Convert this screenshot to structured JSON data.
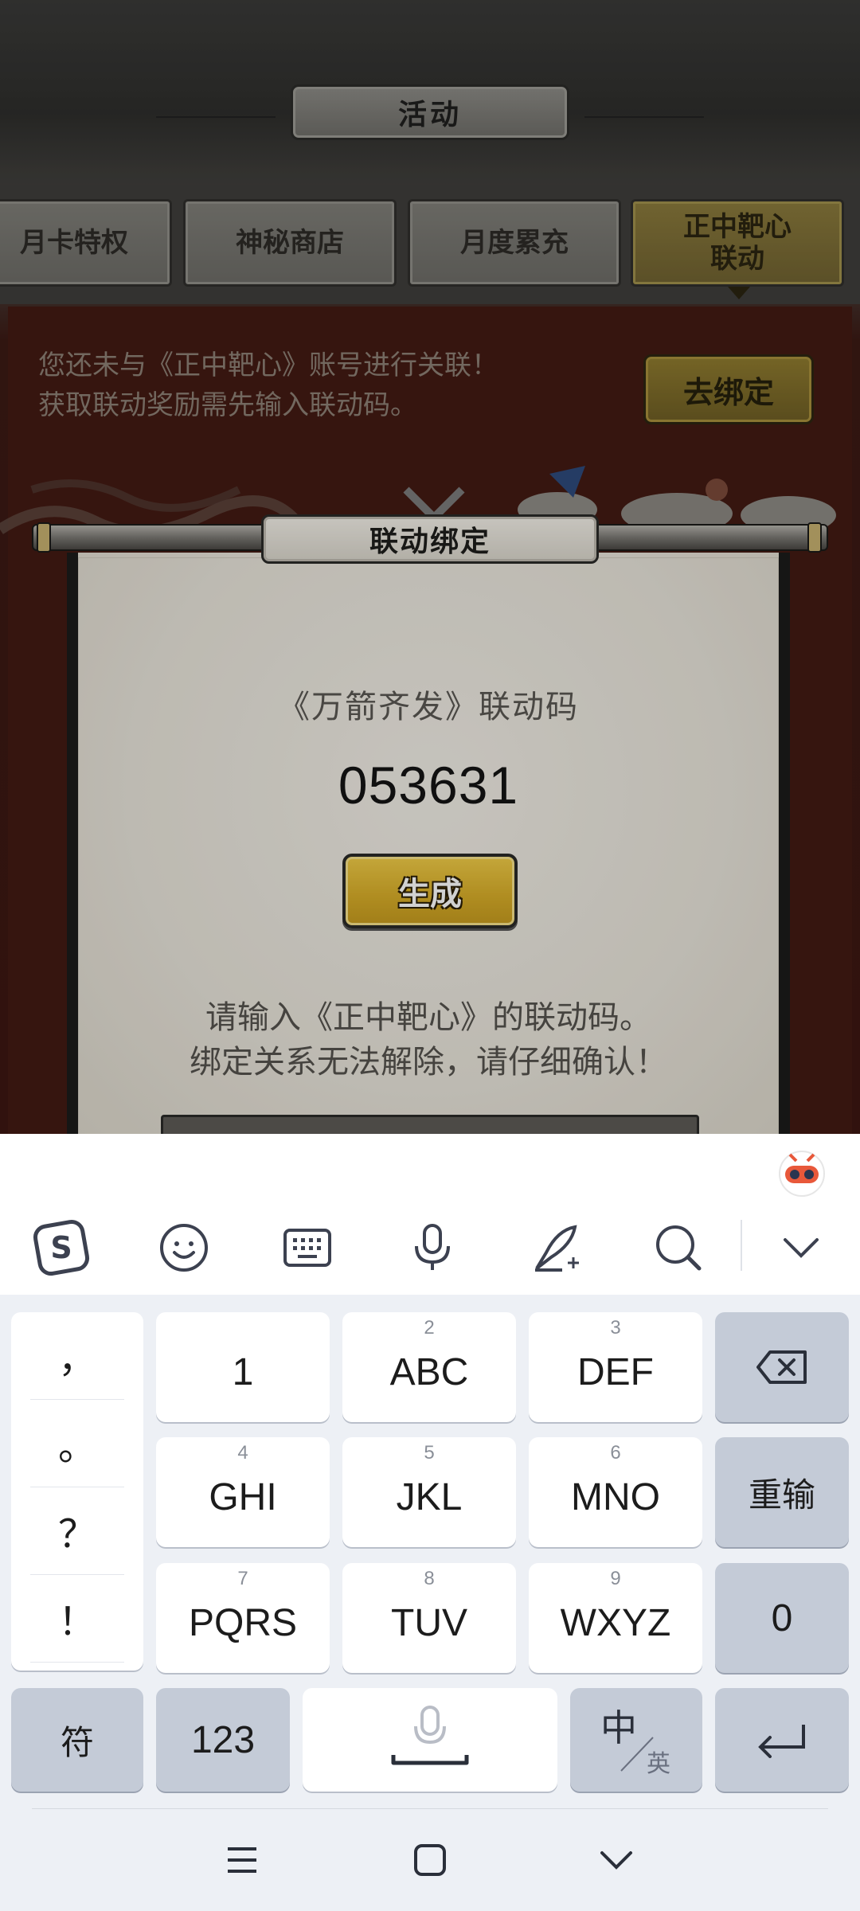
{
  "game": {
    "header_title": "活动",
    "tabs": [
      {
        "label": "月卡特权"
      },
      {
        "label": "神秘商店"
      },
      {
        "label": "月度累充"
      },
      {
        "label": "正中靶心\n联动"
      }
    ],
    "notice": "您还未与《正中靶心》账号进行关联！\n获取联动奖励需先输入联动码。",
    "bind_button": "去绑定",
    "dialog": {
      "title": "联动绑定",
      "code_label": "《万箭齐发》联动码",
      "code_value": "053631",
      "generate_button": "生成",
      "instructions": "请输入《正中靶心》的联动码。\n绑定关系无法解除，请仔细确认！"
    }
  },
  "keyboard": {
    "toolbar": [
      {
        "icon": "sogou-logo-icon"
      },
      {
        "icon": "emoji-icon"
      },
      {
        "icon": "keyboard-icon"
      },
      {
        "icon": "microphone-icon"
      },
      {
        "icon": "handwriting-icon"
      },
      {
        "icon": "search-icon"
      },
      {
        "icon": "chevron-down-icon"
      }
    ],
    "punctuation": [
      "，",
      "。",
      "？",
      "！"
    ],
    "keys": {
      "k1": {
        "main": "1",
        "sup": ""
      },
      "k2": {
        "main": "ABC",
        "sup": "2"
      },
      "k3": {
        "main": "DEF",
        "sup": "3"
      },
      "k4": {
        "main": "GHI",
        "sup": "4"
      },
      "k5": {
        "main": "JKL",
        "sup": "5"
      },
      "k6": {
        "main": "MNO",
        "sup": "6"
      },
      "k7": {
        "main": "PQRS",
        "sup": "7"
      },
      "k8": {
        "main": "TUV",
        "sup": "8"
      },
      "k9": {
        "main": "WXYZ",
        "sup": "9"
      },
      "reenter": "重输",
      "zero": "0",
      "symbols": "符",
      "numbers": "123",
      "lang_cn": "中",
      "lang_en": "英"
    },
    "nav": [
      {
        "icon": "menu-icon"
      },
      {
        "icon": "home-icon"
      },
      {
        "icon": "back-icon"
      }
    ]
  }
}
